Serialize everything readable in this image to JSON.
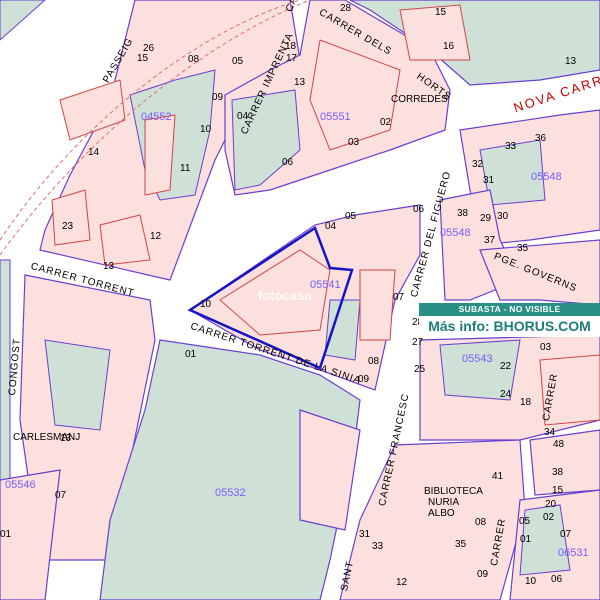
{
  "banner": {
    "status": "SUBASTA - NO VISIBLE",
    "more_info": "Más info: BHORUS.COM"
  },
  "watermark": "fotocasa",
  "colors": {
    "parcel_fill": "#fbe0de",
    "parcel_line": "#6a3fd1",
    "building_line": "#d24545",
    "green_area": "#cfe0d6",
    "selected_outline": "#1414c8",
    "banner_green": "#2a8f84",
    "cadastral_text": "#7a5cff",
    "main_road_label": "#c00000"
  },
  "cadastral_ids": [
    "04552",
    "05551",
    "05548",
    "05548",
    "05541",
    "05543",
    "05546",
    "05532",
    "06531"
  ],
  "street_labels": {
    "passeig": "PASSEIG",
    "carrer_dels": "CARRER DELS",
    "horts": "HORTS",
    "nova_carrer": "NOVA CARRE",
    "carrer_imprenta": "CARRER IMPRENTA",
    "carrer_figuero": "CARRER DEL FIGUERO",
    "carrer_torrent": "CARRER TORRENT",
    "carrer_torrent_sinia": "CARRER TORRENT DE LA SINIA",
    "pge_goberns": "PGE. GOVERNS",
    "congost": "CONGOST",
    "carlesmanj": "CARLESMANJ",
    "carrer_francesc": "CARRER FRANCESC",
    "sant": "SANT",
    "carrer_right": "CARRER",
    "carrer_bottom": "CARRER",
    "biblioteca": "BIBLIOTECA",
    "nuria": "NURIA",
    "albo": "ALBO",
    "corredes": "CORREDES"
  },
  "parcel_numbers": [
    "15",
    "16",
    "13",
    "26",
    "15",
    "08",
    "05",
    "09",
    "10",
    "11",
    "12",
    "14",
    "23",
    "13",
    "28",
    "18",
    "17",
    "13",
    "02",
    "03",
    "04",
    "05",
    "06",
    "07",
    "08",
    "09",
    "10",
    "01",
    "07",
    "32",
    "33",
    "31",
    "38",
    "29",
    "30",
    "35",
    "36",
    "37",
    "04",
    "06",
    "02",
    "03",
    "18",
    "41",
    "48",
    "28",
    "27",
    "25",
    "24",
    "22",
    "15",
    "34",
    "38",
    "20",
    "05",
    "01",
    "02",
    "07",
    "31",
    "33",
    "35",
    "08",
    "09",
    "06",
    "10",
    "12",
    "13",
    "01"
  ]
}
